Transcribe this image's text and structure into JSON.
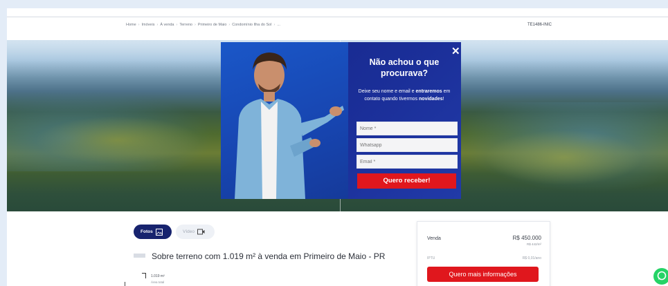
{
  "breadcrumb": [
    "Home",
    "Imóveis",
    "À venda",
    "Terreno",
    "Primeiro de Maio",
    "Condomínio Ilha do Sol",
    "..."
  ],
  "ref_code": "TE1486-INIC",
  "popup": {
    "close": "✕",
    "title": "Não achou o que procurava?",
    "text_1": "Deixe seu nome e email e ",
    "text_bold_1": "entraremos",
    "text_2": " em contato quando tivermos ",
    "text_bold_2": "novidades",
    "text_3": "!",
    "name_placeholder": "Nome *",
    "whatsapp_placeholder": "Whatsapp",
    "email_placeholder": "Email *",
    "submit": "Quero receber!"
  },
  "tabs": {
    "photos": "Fotos",
    "video": "Vídeo"
  },
  "property": {
    "title": "Sobre terreno com 1.019 m² à venda em Primeiro de Maio - PR",
    "area_value": "1.019 m²",
    "area_label": "Área total"
  },
  "price_card": {
    "sale_label": "Venda",
    "sale_value": "R$ 450.000",
    "per_m2": "R$ 442/m²",
    "iptu_label": "IPTU",
    "iptu_value": "R$ 0,01/ano",
    "cta": "Quero mais informações"
  },
  "colors": {
    "brand_navy": "#17236e",
    "cta_red": "#e0171d",
    "whatsapp": "#25d366"
  }
}
